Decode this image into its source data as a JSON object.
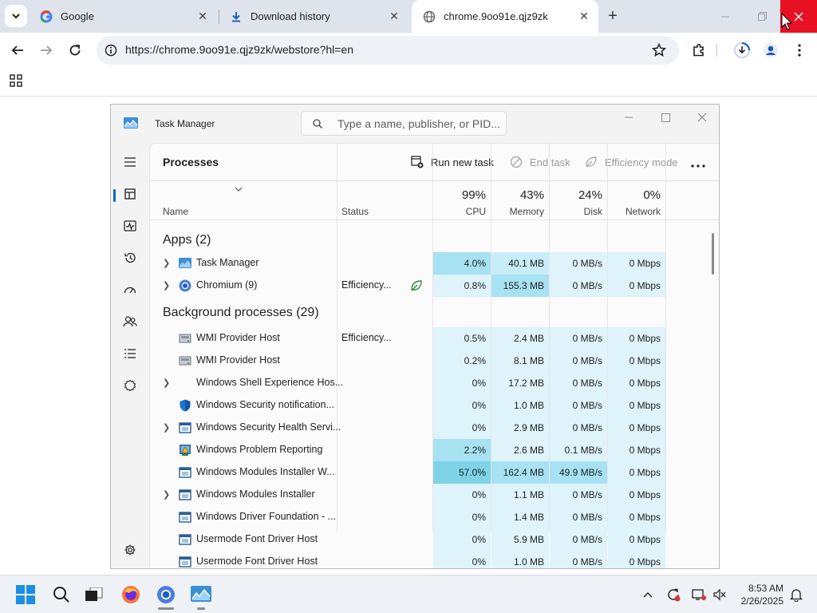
{
  "browser": {
    "tabs": [
      {
        "title": "Google",
        "favicon": "google-icon",
        "active": false
      },
      {
        "title": "Download history",
        "favicon": "download-icon",
        "active": false
      },
      {
        "title": "chrome.9oo91e.qjz9zk",
        "favicon": "globe-icon",
        "active": true
      }
    ],
    "url": "https://chrome.9oo91e.qjz9zk/webstore?hl=en",
    "colors": {
      "tabstrip": "#dfe3eb",
      "close_hover": "#e81123"
    }
  },
  "task_manager": {
    "window_title": "Task Manager",
    "search_placeholder": "Type a name, publisher, or PID...",
    "section_title": "Processes",
    "actions": {
      "run_new_task": "Run new task",
      "end_task": "End task",
      "efficiency_mode": "Efficiency mode"
    },
    "columns": {
      "name": "Name",
      "status": "Status",
      "cpu_pct": "99%",
      "cpu": "CPU",
      "memory_pct": "43%",
      "memory": "Memory",
      "disk_pct": "24%",
      "disk": "Disk",
      "network_pct": "0%",
      "network": "Network"
    },
    "groups": {
      "apps": "Apps (2)",
      "background": "Background processes (29)"
    },
    "apps": [
      {
        "name": "Task Manager",
        "status": "",
        "cpu": "4.0%",
        "memory": "40.1 MB",
        "disk": "0 MB/s",
        "network": "0 Mbps",
        "icon": "task-manager-icon",
        "expandable": true
      },
      {
        "name": "Chromium (9)",
        "status": "Efficiency...",
        "cpu": "0.8%",
        "memory": "155.3 MB",
        "disk": "0 MB/s",
        "network": "0 Mbps",
        "icon": "chromium-icon",
        "expandable": true,
        "efficiency_leaf": true
      }
    ],
    "background": [
      {
        "name": "WMI Provider Host",
        "status": "Efficiency...",
        "cpu": "0.5%",
        "memory": "2.4 MB",
        "disk": "0 MB/s",
        "network": "0 Mbps",
        "icon": "wmi-icon",
        "expandable": false
      },
      {
        "name": "WMI Provider Host",
        "status": "",
        "cpu": "0.2%",
        "memory": "8.1 MB",
        "disk": "0 MB/s",
        "network": "0 Mbps",
        "icon": "wmi-icon",
        "expandable": false
      },
      {
        "name": "Windows Shell Experience Hos...",
        "status": "",
        "cpu": "0%",
        "memory": "17.2 MB",
        "disk": "0 MB/s",
        "network": "0 Mbps",
        "icon": "",
        "expandable": true
      },
      {
        "name": "Windows Security notification...",
        "status": "",
        "cpu": "0%",
        "memory": "1.0 MB",
        "disk": "0 MB/s",
        "network": "0 Mbps",
        "icon": "shield-icon",
        "expandable": false
      },
      {
        "name": "Windows Security Health Servi...",
        "status": "",
        "cpu": "0%",
        "memory": "2.9 MB",
        "disk": "0 MB/s",
        "network": "0 Mbps",
        "icon": "app-window-icon",
        "expandable": true
      },
      {
        "name": "Windows Problem Reporting",
        "status": "",
        "cpu": "2.2%",
        "memory": "2.6 MB",
        "disk": "0.1 MB/s",
        "network": "0 Mbps",
        "icon": "problem-report-icon",
        "expandable": false
      },
      {
        "name": "Windows Modules Installer W...",
        "status": "",
        "cpu": "57.0%",
        "memory": "162.4 MB",
        "disk": "49.9 MB/s",
        "network": "0 Mbps",
        "icon": "app-window-icon",
        "expandable": false
      },
      {
        "name": "Windows Modules Installer",
        "status": "",
        "cpu": "0%",
        "memory": "1.1 MB",
        "disk": "0 MB/s",
        "network": "0 Mbps",
        "icon": "app-window-icon",
        "expandable": true
      },
      {
        "name": "Windows Driver Foundation - ...",
        "status": "",
        "cpu": "0%",
        "memory": "1.4 MB",
        "disk": "0 MB/s",
        "network": "0 Mbps",
        "icon": "app-window-icon",
        "expandable": false
      },
      {
        "name": "Usermode Font Driver Host",
        "status": "",
        "cpu": "0%",
        "memory": "5.9 MB",
        "disk": "0 MB/s",
        "network": "0 Mbps",
        "icon": "app-window-icon",
        "expandable": false
      },
      {
        "name": "Usermode Font Driver Host",
        "status": "",
        "cpu": "0%",
        "memory": "1.0 MB",
        "disk": "0 MB/s",
        "network": "0 Mbps",
        "icon": "app-window-icon",
        "expandable": false
      }
    ],
    "heat_colors": {
      "h1": "#def3fa",
      "h2": "#c6edf8",
      "h3": "#a6e2f2",
      "h4": "#7fd3e7"
    }
  },
  "taskbar": {
    "time": "8:53 AM",
    "date": "2/26/2025"
  }
}
